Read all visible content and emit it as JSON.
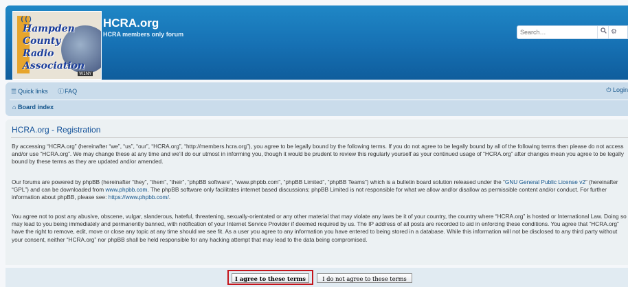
{
  "site": {
    "title": "HCRA.org",
    "description": "HCRA members only forum",
    "logo_lines": [
      "Hampden",
      "County",
      "Radio",
      "Association"
    ],
    "logo_tag": "W1NY"
  },
  "search": {
    "placeholder": "Search…",
    "search_icon": "magnifier-icon",
    "advanced_icon": "gear-icon"
  },
  "nav": {
    "quick_links": "Quick links",
    "faq": "FAQ",
    "login": "Login",
    "board_index": "Board index"
  },
  "registration": {
    "title": "HCRA.org - Registration",
    "p1": "By accessing “HCRA.org” (hereinafter “we”, “us”, “our”, “HCRA.org”, “http://members.hcra.org”), you agree to be legally bound by the following terms. If you do not agree to be legally bound by all of the following terms then please do not access and/or use “HCRA.org”. We may change these at any time and we’ll do our utmost in informing you, though it would be prudent to review this regularly yourself as your continued usage of “HCRA.org” after changes mean you agree to be legally bound by these terms as they are updated and/or amended.",
    "p2_a": "Our forums are powered by phpBB (hereinafter “they”, “them”, “their”, “phpBB software”, “www.phpbb.com”, “phpBB Limited”, “phpBB Teams”) which is a bulletin board solution released under the “",
    "p2_link1": "GNU General Public License v2",
    "p2_b": "” (hereinafter “GPL”) and can be downloaded from ",
    "p2_link2": "www.phpbb.com",
    "p2_c": ". The phpBB software only facilitates internet based discussions; phpBB Limited is not responsible for what we allow and/or disallow as permissible content and/or conduct. For further information about phpBB, please see: ",
    "p2_link3": "https://www.phpbb.com/",
    "p2_d": ".",
    "p3": "You agree not to post any abusive, obscene, vulgar, slanderous, hateful, threatening, sexually-orientated or any other material that may violate any laws be it of your country, the country where “HCRA.org” is hosted or International Law. Doing so may lead to you being immediately and permanently banned, with notification of your Internet Service Provider if deemed required by us. The IP address of all posts are recorded to aid in enforcing these conditions. You agree that “HCRA.org” have the right to remove, edit, move or close any topic at any time should we see fit. As a user you agree to any information you have entered to being stored in a database. While this information will not be disclosed to any third party without your consent, neither “HCRA.org” nor phpBB shall be held responsible for any hacking attempt that may lead to the data being compromised."
  },
  "buttons": {
    "agree": "I agree to these terms",
    "disagree": "I do not agree to these terms"
  },
  "colors": {
    "header": "#1670b3",
    "navbar": "#cadceb",
    "panel": "#ecf1f3",
    "link": "#105289",
    "highlight": "#c4151c"
  }
}
